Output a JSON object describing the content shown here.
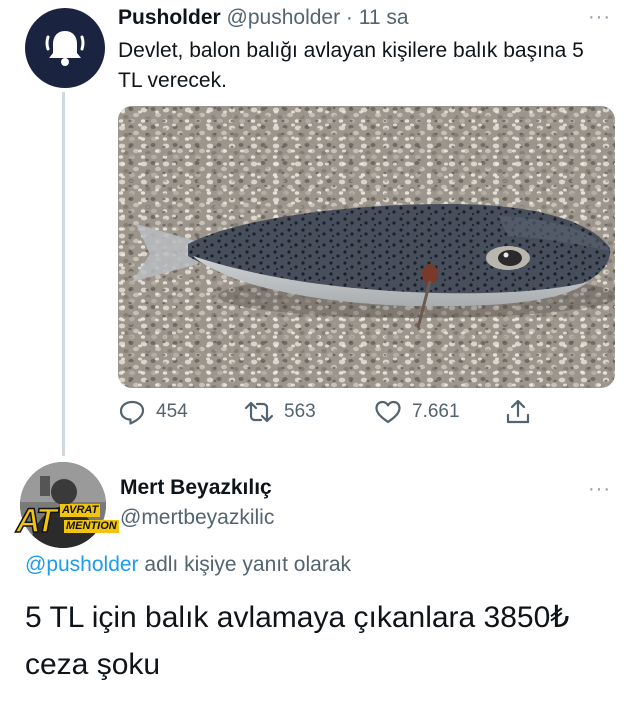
{
  "tweet1": {
    "author_name": "Pusholder",
    "handle": "@pusholder",
    "separator": " · ",
    "time": "11 sa",
    "text": "Devlet, balon balığı avlayan kişilere balık başına 5 TL verecek.",
    "avatar_icon": "bell-icon",
    "media_alt": "puffer-fish-on-pebbles-photo",
    "stats": {
      "replies": "454",
      "retweets": "563",
      "likes": "7.661"
    }
  },
  "tweet2": {
    "author_name": "Mert Beyazkılıç",
    "handle": "@mertbeyazkilic",
    "reply_to_mention": "@pusholder",
    "reply_to_suffix": " adlı kişiye yanıt olarak",
    "text": "5 TL için balık avlamaya çıkanlara 3850₺ ceza şoku",
    "avatar_logo": {
      "big": "AT",
      "top": "AVRAT",
      "bottom": "MENTION"
    }
  },
  "more_menu": "···",
  "colors": {
    "accent": "#1d9bf0",
    "muted": "#536471",
    "avatar_bg": "#1a2340",
    "logo_yellow": "#f1c40f"
  }
}
